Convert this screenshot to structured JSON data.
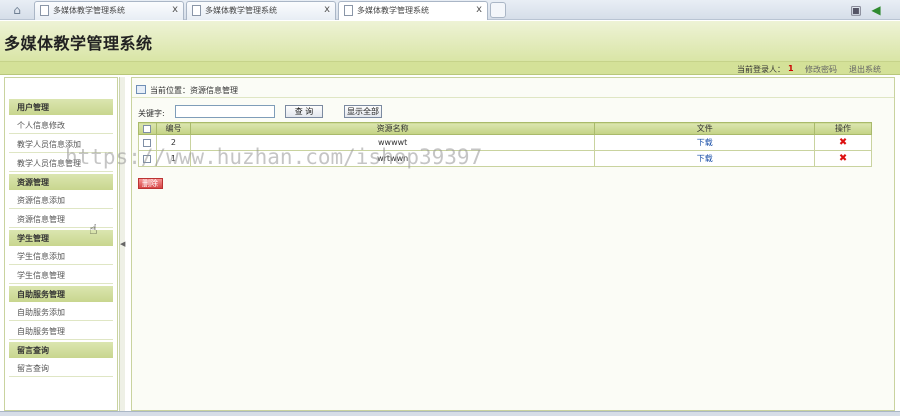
{
  "browser": {
    "tabs": [
      {
        "label": "多媒体教学管理系统"
      },
      {
        "label": "多媒体教学管理系统"
      },
      {
        "label": "多媒体教学管理系统"
      }
    ],
    "close_glyph": "x"
  },
  "header": {
    "site_title": "多媒体教学管理系统",
    "current_user_label": "当前登录人：",
    "current_user": "1",
    "change_password": "修改密码",
    "logout": "退出系统"
  },
  "sidebar": {
    "sections": [
      {
        "title": "用户管理",
        "items": [
          "个人信息修改",
          "教学人员信息添加",
          "教学人员信息管理"
        ]
      },
      {
        "title": "资源管理",
        "items": [
          "资源信息添加",
          "资源信息管理"
        ]
      },
      {
        "title": "学生管理",
        "items": [
          "学生信息添加",
          "学生信息管理"
        ]
      },
      {
        "title": "自助服务管理",
        "items": [
          "自助服务添加",
          "自助服务管理"
        ]
      },
      {
        "title": "留言查询",
        "items": [
          "留言查询"
        ]
      }
    ]
  },
  "main": {
    "breadcrumb": "当前位置：资源信息管理",
    "search": {
      "label": "关键字:",
      "value": "",
      "placeholder": "",
      "search_button": "查 询",
      "show_all_button": "显示全部"
    },
    "table": {
      "headers": [
        "",
        "编号",
        "资源名称",
        "文件",
        "操作"
      ],
      "rows": [
        {
          "id": "2",
          "name": "wwwwt",
          "file": "下载",
          "action": "✖"
        },
        {
          "id": "1",
          "name": "wrtwwn",
          "file": "下载",
          "action": "✖"
        }
      ]
    },
    "delete_button": "删除"
  },
  "watermark": "https://www.huzhan.com/ishop39397",
  "colors": {
    "header_green": "#d9e5a6",
    "accent_red": "#d11111",
    "link_blue": "#1a4fa8"
  },
  "icons": {
    "home": "home-icon",
    "page": "page-icon",
    "delete": "delete-x-icon",
    "cursor": "hand-cursor-icon"
  }
}
